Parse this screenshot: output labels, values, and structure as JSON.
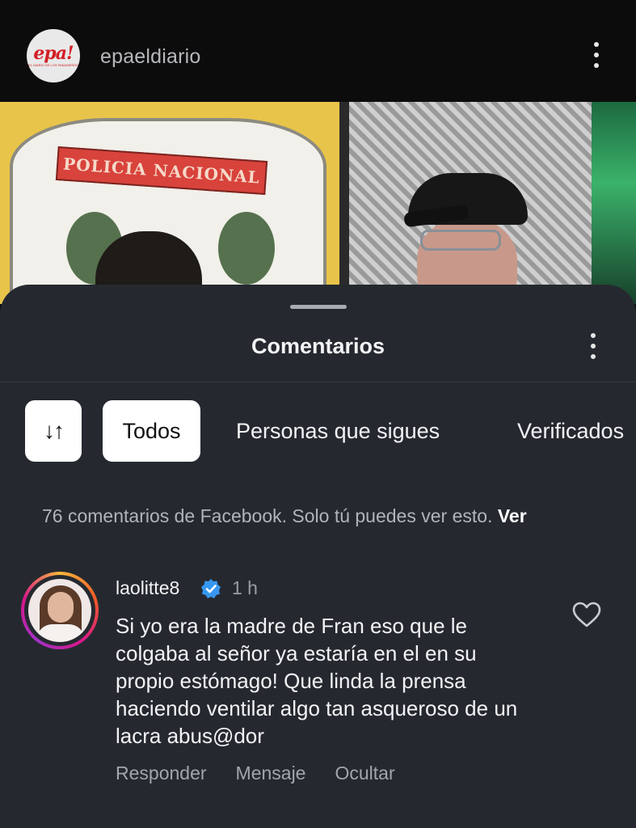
{
  "header": {
    "logo_wordmark": "epa!",
    "logo_tagline": "EL DIARIO DE LOS PANAMEÑOS",
    "account_name": "epaeldiario",
    "menu_icon": "more-vertical-icon"
  },
  "media": {
    "badge_text": "POLICIA NACIONAL"
  },
  "sheet": {
    "title": "Comentarios",
    "menu_icon": "more-vertical-icon",
    "filters": {
      "sort_icon": "sort-arrows-icon",
      "sort_glyph": "↓↑",
      "chips": [
        "Todos",
        "Personas que sigues",
        "Verificados"
      ],
      "selected": "Todos"
    },
    "facebook_note": {
      "text": "76 comentarios de Facebook. Solo tú puedes ver esto.",
      "link": "Ver"
    }
  },
  "comment": {
    "username": "laolitte8",
    "verified_icon": "verified-badge-icon",
    "time": "1 h",
    "text": "Si yo era la madre de Fran eso que le colgaba al señor ya estaría en el en su propio estómago! Que linda la prensa haciendo ventilar algo tan asqueroso de un lacra abus@dor",
    "like_icon": "heart-outline-icon",
    "actions": [
      "Responder",
      "Mensaje",
      "Ocultar"
    ]
  },
  "colors": {
    "sheet_bg": "#25292f",
    "page_bg": "#0c0c0d",
    "verified_blue": "#3797f0",
    "brand_red": "#d21f25"
  }
}
